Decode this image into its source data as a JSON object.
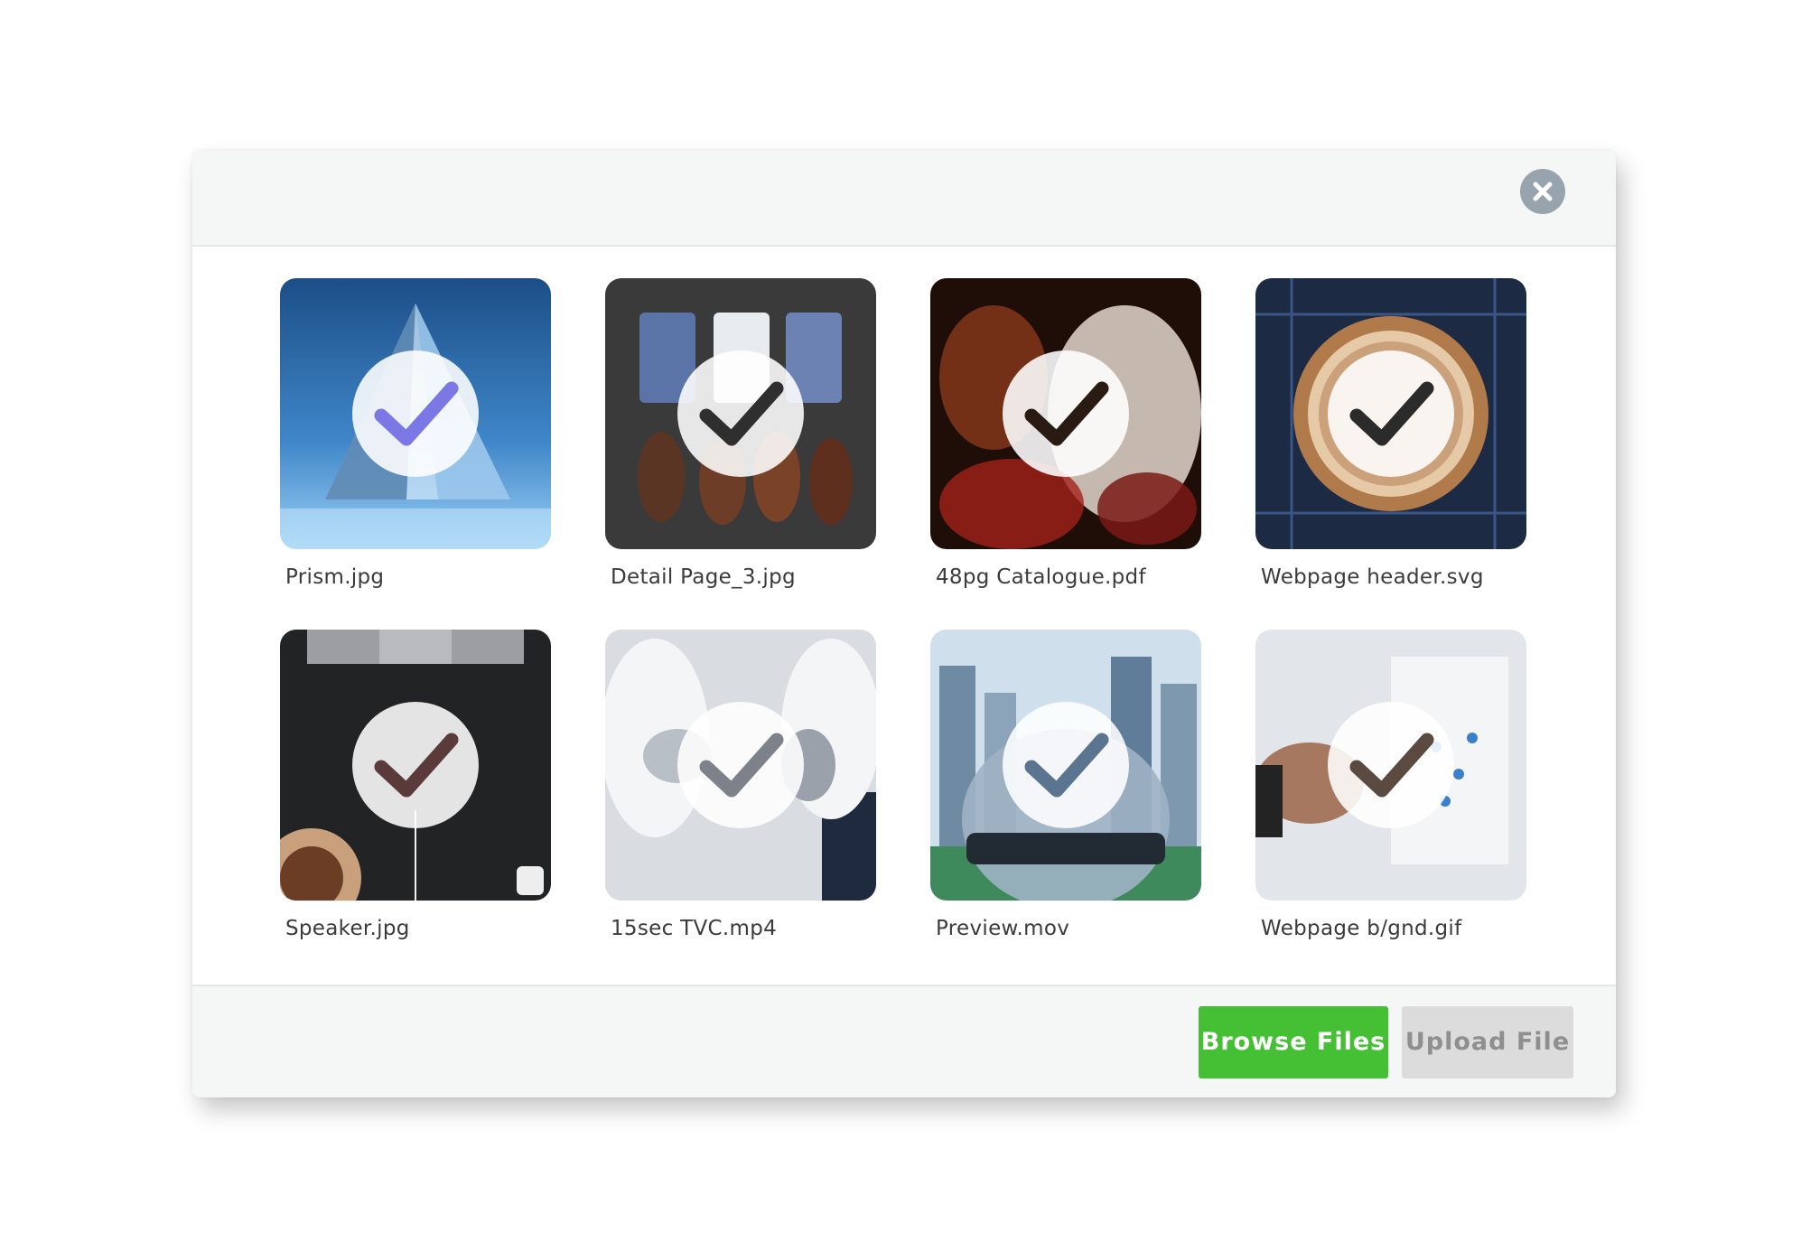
{
  "dialog": {
    "close_icon": "close-icon",
    "colors": {
      "header_bg": "#f5f6f6",
      "close_bg": "#97a3ad",
      "browse_bg": "#45bf34",
      "upload_bg": "#dcdcdc"
    }
  },
  "files": [
    {
      "name": "Prism.jpg",
      "selected": true
    },
    {
      "name": "Detail Page_3.jpg",
      "selected": true
    },
    {
      "name": "48pg Catalogue.pdf",
      "selected": true
    },
    {
      "name": "Webpage header.svg",
      "selected": true
    },
    {
      "name": "Speaker.jpg",
      "selected": true
    },
    {
      "name": "15sec TVC.mp4",
      "selected": true
    },
    {
      "name": "Preview.mov",
      "selected": true
    },
    {
      "name": "Webpage b/gnd.gif",
      "selected": true
    }
  ],
  "footer": {
    "browse_label": "Browse Files",
    "upload_label": "Upload File"
  }
}
